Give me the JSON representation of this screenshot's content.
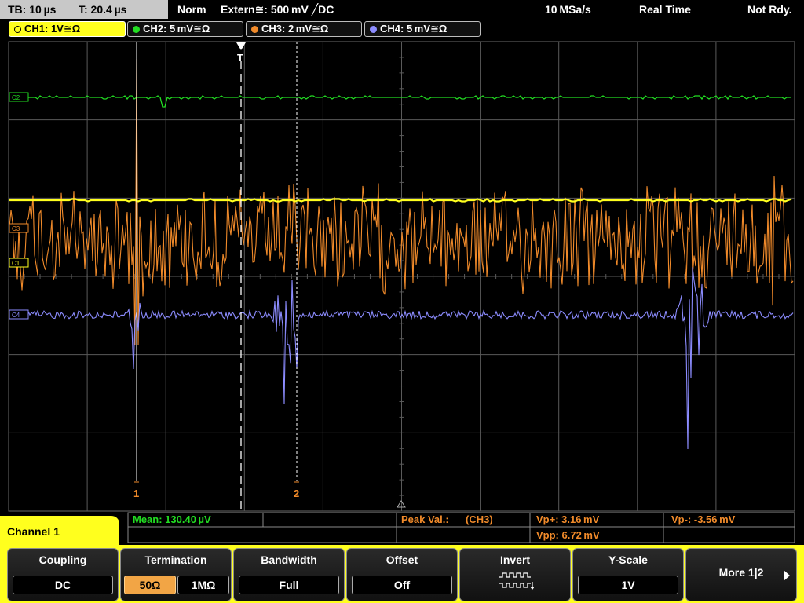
{
  "status": {
    "timebase": "TB: 10 µs",
    "trigger_time": "T: 20.4 µs",
    "mode": "Norm",
    "trigger_source": "Extern≅: 500 mV ╱DC",
    "sample_rate": "10 MSa/s",
    "acq_mode": "Real Time",
    "ready_state": "Not Rdy."
  },
  "channels": [
    {
      "label": "CH1: 1V≅Ω",
      "color": "#ffff1e",
      "active": true
    },
    {
      "label": "CH2: 5 mV≅Ω",
      "color": "#22dd22",
      "active": false
    },
    {
      "label": "CH3: 2 mV≅Ω",
      "color": "#f08a2a",
      "active": false
    },
    {
      "label": "CH4: 5 mV≅Ω",
      "color": "#8c8cff",
      "active": false
    }
  ],
  "trace_markers": {
    "ch2": "C2",
    "ch3": "C3",
    "ch1": "C1",
    "ch4": "C4"
  },
  "cursors": {
    "cursor1_label": "1",
    "cursor2_label": "2",
    "trigger_label": "T"
  },
  "info": {
    "menu_title": "Channel 1",
    "mean": "Mean: 130.40 µV",
    "peak_label": "Peak Val.:",
    "peak_source": "(CH3)",
    "vp_plus": "Vp+: 3.16 mV",
    "vp_minus": "Vp-: -3.56 mV",
    "vpp": "Vpp: 6.72 mV"
  },
  "softkeys": {
    "coupling": {
      "title": "Coupling",
      "value": "DC"
    },
    "termination": {
      "title": "Termination",
      "opt1": "50Ω",
      "opt2": "1MΩ"
    },
    "bandwidth": {
      "title": "Bandwidth",
      "value": "Full"
    },
    "offset": {
      "title": "Offset",
      "value": "Off"
    },
    "invert": {
      "title": "Invert"
    },
    "yscale": {
      "title": "Y-Scale",
      "value": "1V"
    },
    "more": {
      "label": "More 1|2"
    }
  },
  "colors": {
    "ch1": "#ffff1e",
    "ch2": "#22dd22",
    "ch3": "#f08a2a",
    "ch4": "#8c8cff",
    "grid": "#5a5a5a"
  }
}
